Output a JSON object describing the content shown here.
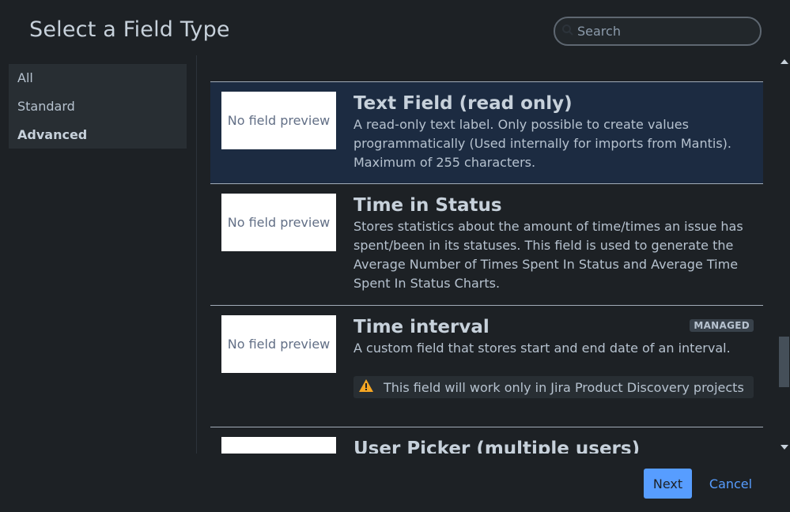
{
  "dialog": {
    "title": "Select a Field Type",
    "search_placeholder": "Search"
  },
  "sidebar": {
    "items": [
      {
        "label": "All",
        "active": false
      },
      {
        "label": "Standard",
        "active": false
      },
      {
        "label": "Advanced",
        "active": true
      }
    ]
  },
  "cards": [
    {
      "preview": "No field preview",
      "title": "Text Field (read only)",
      "description": "A read-only text label. Only possible to create values programmatically (Used internally for imports from Mantis). Maximum of 255 characters.",
      "selected": true
    },
    {
      "preview": "No field preview",
      "title": "Time in Status",
      "description": "Stores statistics about the amount of time/times an issue has spent/been in its statuses. This field is used to generate the Average Number of Times Spent In Status and Average Time Spent In Status Charts.",
      "selected": false
    },
    {
      "preview": "No field preview",
      "title": "Time interval",
      "badge": "MANAGED",
      "description": "A custom field that stores start and end date of an interval.",
      "warning": "This field will work only in Jira Product Discovery projects",
      "selected": false
    },
    {
      "preview": "",
      "title": "User Picker (multiple users)",
      "selected": false
    }
  ],
  "footer": {
    "next_label": "Next",
    "cancel_label": "Cancel"
  },
  "colors": {
    "background": "#1d2125",
    "selected_card": "#1c2b41",
    "primary_button": "#579dff",
    "warning_icon": "#f5a623"
  }
}
